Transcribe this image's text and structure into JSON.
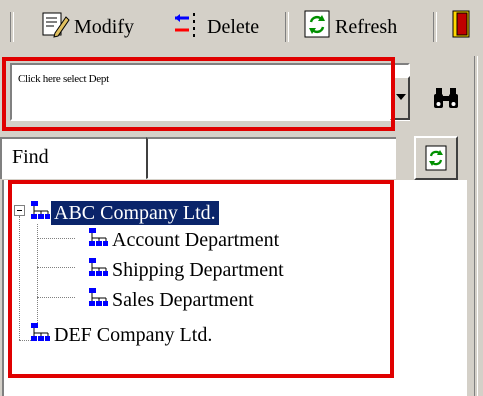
{
  "toolbar": {
    "modify_label": "Modify",
    "delete_label": "Delete",
    "refresh_label": "Refresh"
  },
  "dept_select": {
    "value": "Click here select Dept"
  },
  "find": {
    "label": "Find",
    "value": ""
  },
  "tree": {
    "nodes": [
      {
        "label": "ABC Company Ltd.",
        "selected": true
      },
      {
        "label": "Account Department"
      },
      {
        "label": "Shipping Department"
      },
      {
        "label": "Sales Department"
      },
      {
        "label": "DEF Company Ltd."
      }
    ]
  },
  "colors": {
    "selection": "#0a246a",
    "highlight_box": "#e00000",
    "window_face": "#d4d0c8"
  },
  "icons": [
    "modify-icon",
    "delete-icon",
    "refresh-icon",
    "exit-icon",
    "binoculars-icon",
    "org-chart-icon"
  ]
}
